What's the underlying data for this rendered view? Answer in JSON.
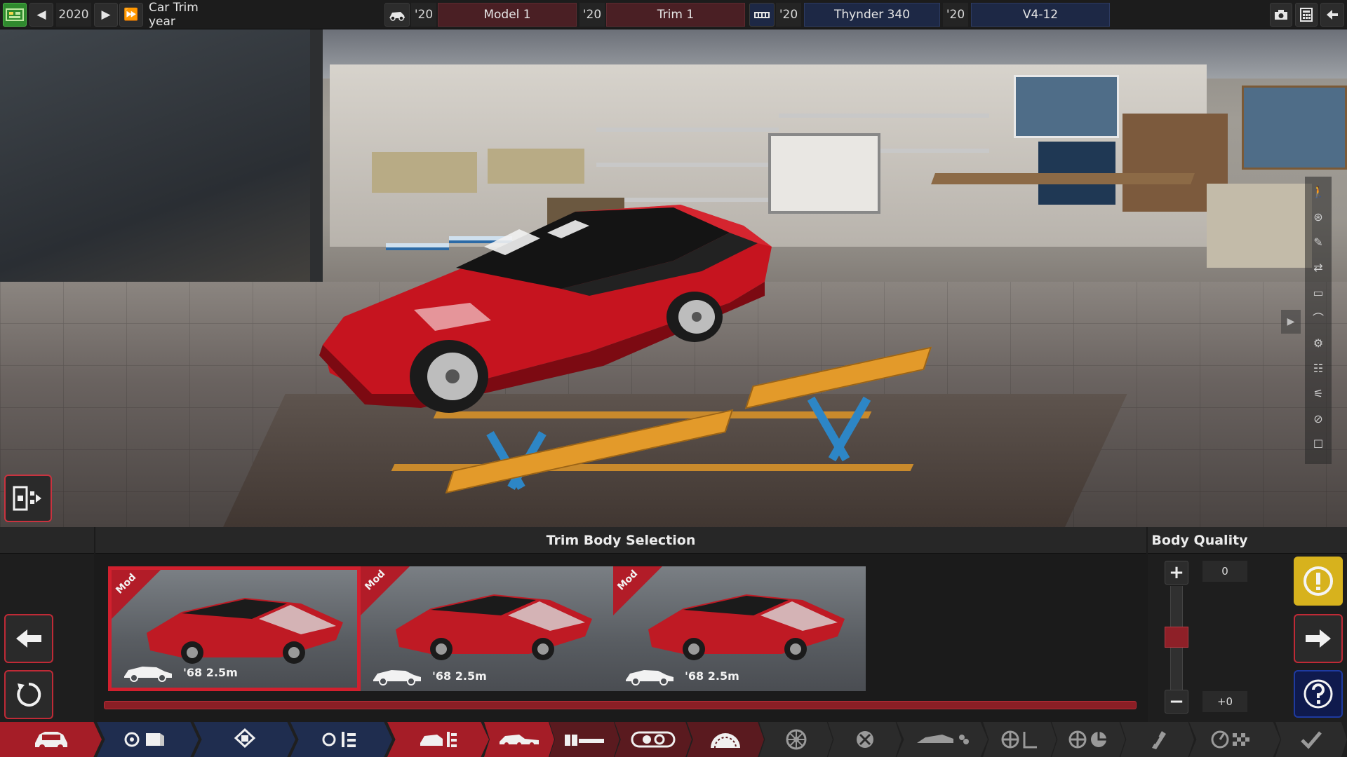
{
  "topbar": {
    "year_value": "2020",
    "year_label": "Car Trim year",
    "model_year": "'20",
    "model_name": "Model 1",
    "trim_year": "'20",
    "trim_name": "Trim 1",
    "family_year": "'20",
    "family_name": "Thynder 340",
    "engine_year": "'20",
    "engine_name": "V4-12"
  },
  "panel": {
    "title": "Trim Body Selection",
    "quality_title": "Body Quality",
    "quality_value": "0",
    "quality_delta": "+0",
    "progress": 1.0,
    "cards": [
      {
        "tag": "Mod",
        "year_size": "'68 2.5m",
        "selected": true
      },
      {
        "tag": "Mod",
        "year_size": "'68 2.5m",
        "selected": false
      },
      {
        "tag": "Mod",
        "year_size": "'68 2.5m",
        "selected": false
      }
    ]
  },
  "colors": {
    "accent_red": "#a51d27",
    "car_red": "#c6141f",
    "warning_yellow": "#d7b21d",
    "help_blue": "#0f1a4d"
  },
  "icons": {
    "topbar_left": [
      "app-logo-icon",
      "prev-icon",
      "play-icon",
      "fast-forward-icon"
    ],
    "topbar_right": [
      "camera-icon",
      "calculator-icon",
      "back-icon"
    ],
    "tabs": [
      "car-icon",
      "engine-family-icon",
      "engine-icon",
      "engine-trim-icon",
      "body-icon",
      "chassis-icon",
      "drivetrain-icon",
      "engine-fuel-icon",
      "exhaust-icon",
      "wheel-icon",
      "brakes-icon",
      "aero-icon",
      "suspension-icon",
      "steering-icon",
      "tyres-icon",
      "test-icon",
      "finish-icon"
    ]
  }
}
